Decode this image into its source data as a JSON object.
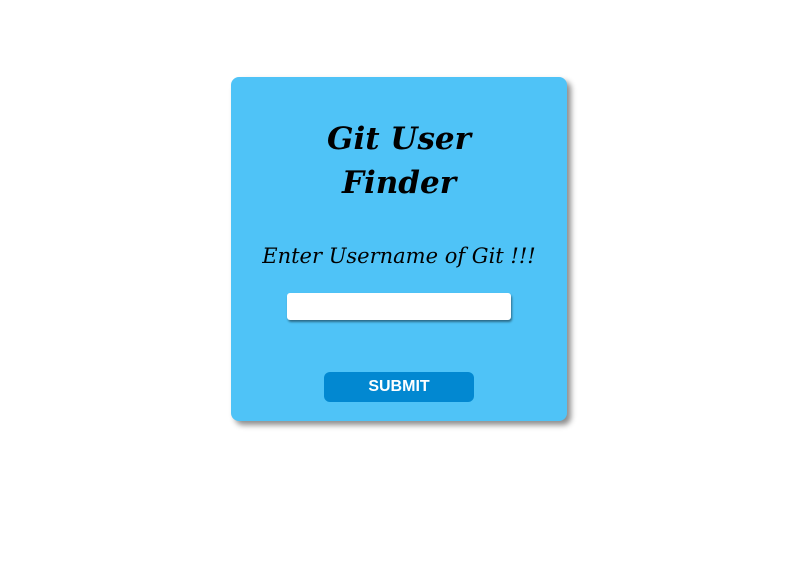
{
  "card": {
    "title_line1": "Git User",
    "title_line2": "Finder",
    "prompt": "Enter Username of Git !!!",
    "username_input": {
      "value": "",
      "placeholder": ""
    },
    "submit_label": "SUBMIT"
  },
  "colors": {
    "card_background": "#4fc3f7",
    "button_background": "#0288d1",
    "button_text": "#ffffff",
    "page_background": "#ffffff"
  }
}
